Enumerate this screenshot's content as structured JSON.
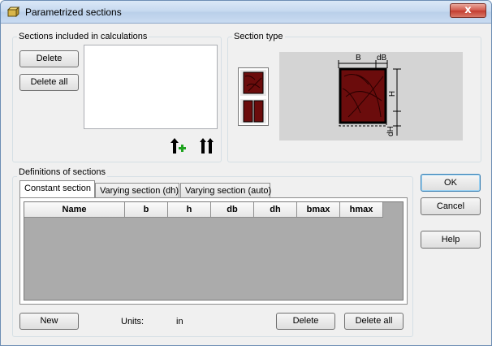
{
  "window": {
    "title": "Parametrized sections",
    "close_glyph": "x"
  },
  "sections_included": {
    "label": "Sections included in calculations",
    "delete_label": "Delete",
    "delete_all_label": "Delete all",
    "icons": [
      "move-up-add-icon",
      "move-all-up-icon"
    ]
  },
  "section_type": {
    "label": "Section type",
    "dimension_labels": {
      "b": "B",
      "db": "dB",
      "h": "H",
      "dh": "dH"
    },
    "colors": {
      "wood": "#6b0c0c",
      "preview_bg": "#d4d4d4"
    }
  },
  "definitions": {
    "label": "Definitions of sections",
    "tabs": [
      {
        "label": "Constant section",
        "active": true
      },
      {
        "label": "Varying section (dh)",
        "active": false
      },
      {
        "label": "Varying section (auto)",
        "active": false
      }
    ],
    "columns": [
      "Name",
      "b",
      "h",
      "db",
      "dh",
      "bmax",
      "hmax"
    ],
    "rows": [],
    "new_label": "New",
    "units_label": "Units:",
    "units_value": "in",
    "delete_label": "Delete",
    "delete_all_label": "Delete all"
  },
  "side_buttons": {
    "ok_label": "OK",
    "cancel_label": "Cancel",
    "help_label": "Help"
  }
}
